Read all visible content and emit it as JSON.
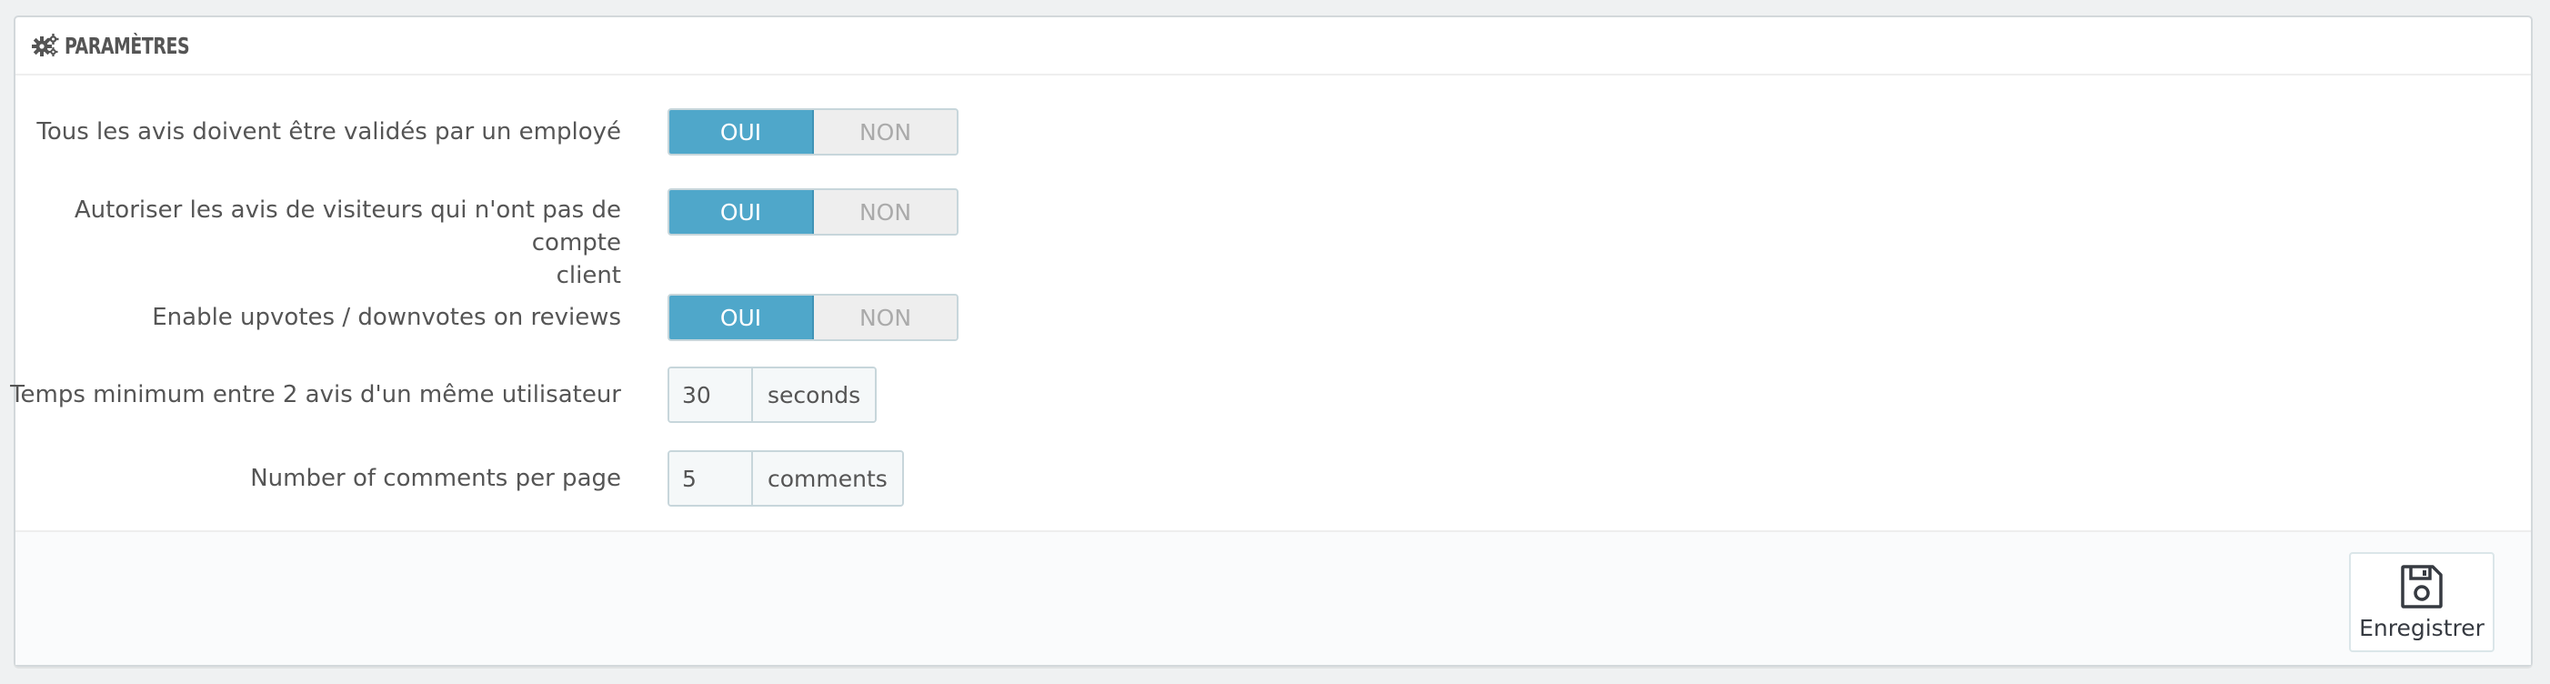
{
  "panel": {
    "title": "PARAMÈTRES",
    "title_icon": "gears-icon"
  },
  "settings": {
    "moderation": {
      "label": "Tous les avis doivent être validés par un employé",
      "yes": "OUI",
      "no": "NON",
      "value": "OUI"
    },
    "guest_reviews": {
      "label_line1": "Autoriser les avis de visiteurs qui n'ont pas de compte",
      "label_line2": "client",
      "yes": "OUI",
      "no": "NON",
      "value": "OUI"
    },
    "usefulness": {
      "label": "Enable upvotes / downvotes on reviews",
      "yes": "OUI",
      "no": "NON",
      "value": "OUI"
    },
    "min_time": {
      "label": "Temps minimum entre 2 avis d'un même utilisateur",
      "value": "30",
      "suffix": "seconds"
    },
    "per_page": {
      "label": "Number of comments per page",
      "value": "5",
      "suffix": "comments"
    }
  },
  "footer": {
    "save_label": "Enregistrer",
    "save_icon": "floppy-disk-icon"
  },
  "colors": {
    "accent": "#4fa7ca",
    "background": "#eff1f2",
    "panel": "#ffffff"
  }
}
